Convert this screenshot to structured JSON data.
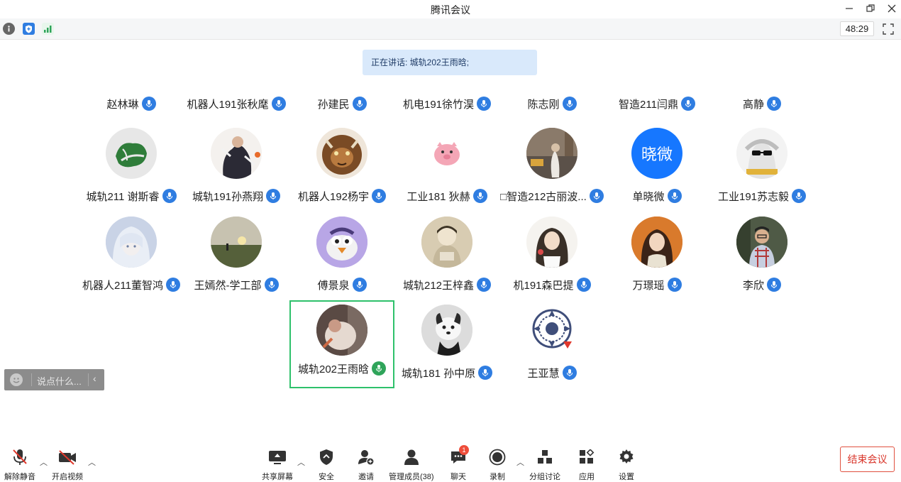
{
  "window": {
    "title": "腾讯会议"
  },
  "infobar": {
    "timer": "48:29"
  },
  "speaking": "正在讲话: 城轨202王雨晗;",
  "name_row": [
    "赵林琳",
    "机器人191张秋麾",
    "孙建民",
    "机电191徐竹淏",
    "陈志刚",
    "智造211闫鼎",
    "高静"
  ],
  "tiles_row1": [
    {
      "name": "城轨211 谢斯睿",
      "avatar": "leaf"
    },
    {
      "name": "城轨191孙燕翔",
      "avatar": "person-dark"
    },
    {
      "name": "机器人192杨宇",
      "avatar": "beast"
    },
    {
      "name": "工业181 狄赫",
      "avatar": "pig"
    },
    {
      "name": "□智造212古丽波...",
      "avatar": "street"
    },
    {
      "name": "单晓微",
      "avatar": "text",
      "avatar_text": "晓微"
    },
    {
      "name": "工业191苏志毅",
      "avatar": "glasses"
    }
  ],
  "tiles_row2": [
    {
      "name": "机器人211董智鸿",
      "avatar": "anime-blue"
    },
    {
      "name": "王嫣然-学工部",
      "avatar": "sunset"
    },
    {
      "name": "傅景泉",
      "avatar": "bird"
    },
    {
      "name": "城轨212王梓鑫",
      "avatar": "sketch"
    },
    {
      "name": "机191森巴提",
      "avatar": "drawing"
    },
    {
      "name": "万璟瑶",
      "avatar": "girl"
    },
    {
      "name": "李欣",
      "avatar": "man"
    }
  ],
  "tiles_row3": [
    {
      "name": "城轨202王雨晗",
      "avatar": "cat-person",
      "active": true
    },
    {
      "name": "城轨181 孙中原",
      "avatar": "dog"
    },
    {
      "name": "王亚慧",
      "avatar": "emblem"
    }
  ],
  "chat": {
    "placeholder": "说点什么..."
  },
  "toolbar": {
    "unmute": "解除静音",
    "start_video": "开启视频",
    "share": "共享屏幕",
    "security": "安全",
    "invite": "邀请",
    "members": "管理成员(38)",
    "chat": "聊天",
    "chat_badge": "1",
    "record": "录制",
    "breakout": "分组讨论",
    "apps": "应用",
    "settings": "设置",
    "end": "结束会议"
  },
  "colors": {
    "accent": "#2f7de1",
    "active_border": "#2ec16b",
    "end": "#d9362b"
  }
}
